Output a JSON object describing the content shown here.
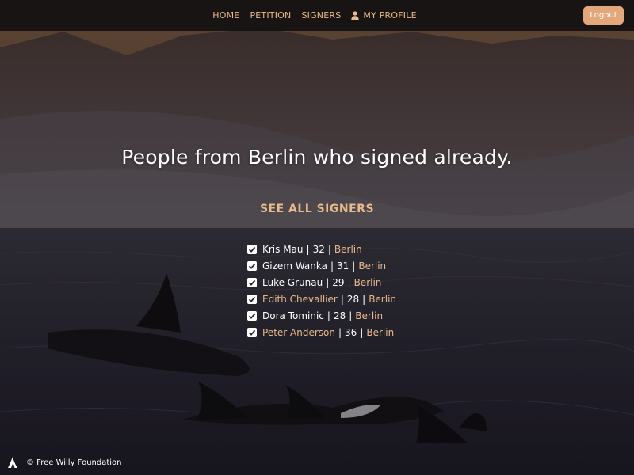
{
  "nav": {
    "links": [
      {
        "label": "HOME"
      },
      {
        "label": "PETITION"
      },
      {
        "label": "SIGNERS"
      },
      {
        "label": "MY PROFILE"
      }
    ],
    "logout_label": "Logout"
  },
  "main": {
    "headline": "People from Berlin who signed already.",
    "see_all_label": "SEE ALL SIGNERS",
    "signers": [
      {
        "name": "Kris Mau",
        "age": "32",
        "city": "Berlin",
        "name_link": false
      },
      {
        "name": "Gizem Wanka",
        "age": "31",
        "city": "Berlin",
        "name_link": false
      },
      {
        "name": "Luke Grunau",
        "age": "29",
        "city": "Berlin",
        "name_link": false
      },
      {
        "name": "Edith Chevallier",
        "age": "28",
        "city": "Berlin",
        "name_link": true
      },
      {
        "name": "Dora Tominic",
        "age": "28",
        "city": "Berlin",
        "name_link": false
      },
      {
        "name": "Peter Anderson",
        "age": "36",
        "city": "Berlin",
        "name_link": true
      }
    ]
  },
  "footer": {
    "copyright": "© Free Willy Foundation"
  },
  "colors": {
    "accent": "#e8b98b",
    "button": "#e2a77a",
    "navbar": "#121010"
  },
  "icons": {
    "profile": "user-icon",
    "checkbox": "check-icon",
    "footer_logo": "orca-logo-icon"
  }
}
